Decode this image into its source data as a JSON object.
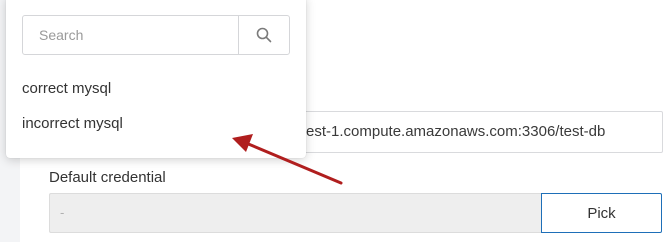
{
  "form": {
    "connection_url_value": "est-1.compute.amazonaws.com:3306/test-db",
    "default_credential_label": "Default credential",
    "default_credential_value": "-",
    "pick_button_label": "Pick"
  },
  "dropdown": {
    "search_placeholder": "Search",
    "search_icon": "search-icon",
    "options": [
      {
        "label": "correct mysql"
      },
      {
        "label": "incorrect mysql"
      }
    ]
  },
  "annotation": {
    "arrow_color": "#b01e1e"
  },
  "colors": {
    "pick_border": "#1e6fb8",
    "disabled_input_bg": "#eeeeee"
  }
}
